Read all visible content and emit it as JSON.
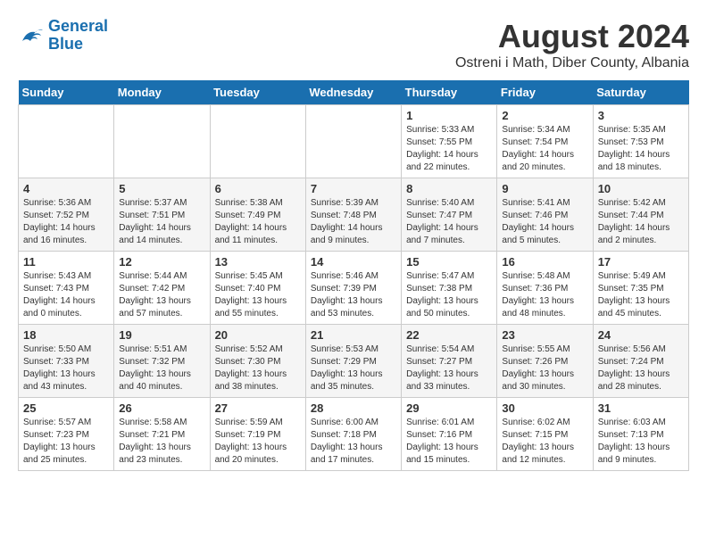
{
  "header": {
    "logo_line1": "General",
    "logo_line2": "Blue",
    "month_year": "August 2024",
    "location": "Ostreni i Math, Diber County, Albania"
  },
  "weekdays": [
    "Sunday",
    "Monday",
    "Tuesday",
    "Wednesday",
    "Thursday",
    "Friday",
    "Saturday"
  ],
  "weeks": [
    [
      {
        "day": "",
        "info": ""
      },
      {
        "day": "",
        "info": ""
      },
      {
        "day": "",
        "info": ""
      },
      {
        "day": "",
        "info": ""
      },
      {
        "day": "1",
        "info": "Sunrise: 5:33 AM\nSunset: 7:55 PM\nDaylight: 14 hours\nand 22 minutes."
      },
      {
        "day": "2",
        "info": "Sunrise: 5:34 AM\nSunset: 7:54 PM\nDaylight: 14 hours\nand 20 minutes."
      },
      {
        "day": "3",
        "info": "Sunrise: 5:35 AM\nSunset: 7:53 PM\nDaylight: 14 hours\nand 18 minutes."
      }
    ],
    [
      {
        "day": "4",
        "info": "Sunrise: 5:36 AM\nSunset: 7:52 PM\nDaylight: 14 hours\nand 16 minutes."
      },
      {
        "day": "5",
        "info": "Sunrise: 5:37 AM\nSunset: 7:51 PM\nDaylight: 14 hours\nand 14 minutes."
      },
      {
        "day": "6",
        "info": "Sunrise: 5:38 AM\nSunset: 7:49 PM\nDaylight: 14 hours\nand 11 minutes."
      },
      {
        "day": "7",
        "info": "Sunrise: 5:39 AM\nSunset: 7:48 PM\nDaylight: 14 hours\nand 9 minutes."
      },
      {
        "day": "8",
        "info": "Sunrise: 5:40 AM\nSunset: 7:47 PM\nDaylight: 14 hours\nand 7 minutes."
      },
      {
        "day": "9",
        "info": "Sunrise: 5:41 AM\nSunset: 7:46 PM\nDaylight: 14 hours\nand 5 minutes."
      },
      {
        "day": "10",
        "info": "Sunrise: 5:42 AM\nSunset: 7:44 PM\nDaylight: 14 hours\nand 2 minutes."
      }
    ],
    [
      {
        "day": "11",
        "info": "Sunrise: 5:43 AM\nSunset: 7:43 PM\nDaylight: 14 hours\nand 0 minutes."
      },
      {
        "day": "12",
        "info": "Sunrise: 5:44 AM\nSunset: 7:42 PM\nDaylight: 13 hours\nand 57 minutes."
      },
      {
        "day": "13",
        "info": "Sunrise: 5:45 AM\nSunset: 7:40 PM\nDaylight: 13 hours\nand 55 minutes."
      },
      {
        "day": "14",
        "info": "Sunrise: 5:46 AM\nSunset: 7:39 PM\nDaylight: 13 hours\nand 53 minutes."
      },
      {
        "day": "15",
        "info": "Sunrise: 5:47 AM\nSunset: 7:38 PM\nDaylight: 13 hours\nand 50 minutes."
      },
      {
        "day": "16",
        "info": "Sunrise: 5:48 AM\nSunset: 7:36 PM\nDaylight: 13 hours\nand 48 minutes."
      },
      {
        "day": "17",
        "info": "Sunrise: 5:49 AM\nSunset: 7:35 PM\nDaylight: 13 hours\nand 45 minutes."
      }
    ],
    [
      {
        "day": "18",
        "info": "Sunrise: 5:50 AM\nSunset: 7:33 PM\nDaylight: 13 hours\nand 43 minutes."
      },
      {
        "day": "19",
        "info": "Sunrise: 5:51 AM\nSunset: 7:32 PM\nDaylight: 13 hours\nand 40 minutes."
      },
      {
        "day": "20",
        "info": "Sunrise: 5:52 AM\nSunset: 7:30 PM\nDaylight: 13 hours\nand 38 minutes."
      },
      {
        "day": "21",
        "info": "Sunrise: 5:53 AM\nSunset: 7:29 PM\nDaylight: 13 hours\nand 35 minutes."
      },
      {
        "day": "22",
        "info": "Sunrise: 5:54 AM\nSunset: 7:27 PM\nDaylight: 13 hours\nand 33 minutes."
      },
      {
        "day": "23",
        "info": "Sunrise: 5:55 AM\nSunset: 7:26 PM\nDaylight: 13 hours\nand 30 minutes."
      },
      {
        "day": "24",
        "info": "Sunrise: 5:56 AM\nSunset: 7:24 PM\nDaylight: 13 hours\nand 28 minutes."
      }
    ],
    [
      {
        "day": "25",
        "info": "Sunrise: 5:57 AM\nSunset: 7:23 PM\nDaylight: 13 hours\nand 25 minutes."
      },
      {
        "day": "26",
        "info": "Sunrise: 5:58 AM\nSunset: 7:21 PM\nDaylight: 13 hours\nand 23 minutes."
      },
      {
        "day": "27",
        "info": "Sunrise: 5:59 AM\nSunset: 7:19 PM\nDaylight: 13 hours\nand 20 minutes."
      },
      {
        "day": "28",
        "info": "Sunrise: 6:00 AM\nSunset: 7:18 PM\nDaylight: 13 hours\nand 17 minutes."
      },
      {
        "day": "29",
        "info": "Sunrise: 6:01 AM\nSunset: 7:16 PM\nDaylight: 13 hours\nand 15 minutes."
      },
      {
        "day": "30",
        "info": "Sunrise: 6:02 AM\nSunset: 7:15 PM\nDaylight: 13 hours\nand 12 minutes."
      },
      {
        "day": "31",
        "info": "Sunrise: 6:03 AM\nSunset: 7:13 PM\nDaylight: 13 hours\nand 9 minutes."
      }
    ]
  ]
}
